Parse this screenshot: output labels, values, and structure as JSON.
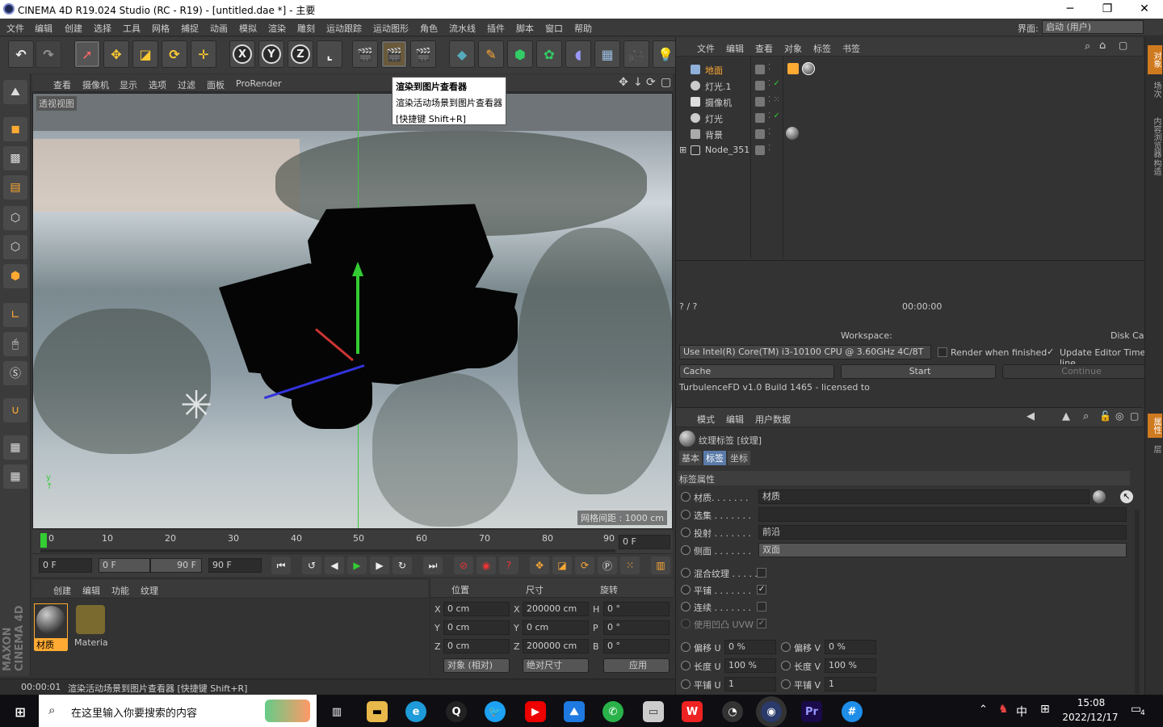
{
  "window": {
    "title": "CINEMA 4D R19.024 Studio (RC - R19) - [untitled.dae *] - 主要",
    "minimize": "─",
    "maximize": "❐",
    "close": "✕"
  },
  "menu": {
    "items": [
      "文件",
      "编辑",
      "创建",
      "选择",
      "工具",
      "网格",
      "捕捉",
      "动画",
      "模拟",
      "渲染",
      "雕刻",
      "运动跟踪",
      "运动图形",
      "角色",
      "流水线",
      "插件",
      "脚本",
      "窗口",
      "帮助"
    ],
    "layout_label": "界面:",
    "layout_value": "启动 (用户)"
  },
  "toolbar": {
    "x": "X",
    "y": "Y",
    "z": "Z"
  },
  "tooltip": {
    "title": "渲染到图片查看器",
    "desc": "渲染活动场景到图片查看器",
    "shortcut": "[快捷键 Shift+R]"
  },
  "viewport": {
    "menu": [
      "查看",
      "摄像机",
      "显示",
      "选项",
      "过滤",
      "面板",
      "ProRender"
    ],
    "name": "透视视图",
    "grid": "网格间距 : 1000 cm"
  },
  "timeline": {
    "ticks": [
      "0",
      "10",
      "20",
      "30",
      "40",
      "50",
      "60",
      "70",
      "80",
      "90"
    ],
    "end": "0 F"
  },
  "controls": {
    "start": "0 F",
    "range_start": "0 F",
    "range_end": "90 F",
    "end": "90 F"
  },
  "materials": {
    "menu": [
      "创建",
      "编辑",
      "功能",
      "纹理"
    ],
    "items": [
      {
        "label": "材质"
      },
      {
        "label": "Materia"
      }
    ]
  },
  "coords": {
    "headers": [
      "位置",
      "尺寸",
      "旋转"
    ],
    "rows": [
      {
        "axis": "X",
        "pos": "0 cm",
        "size": "200000 cm",
        "rot_axis": "H",
        "rot": "0 °"
      },
      {
        "axis": "Y",
        "pos": "0 cm",
        "size": "0 cm",
        "rot_axis": "P",
        "rot": "0 °"
      },
      {
        "axis": "Z",
        "pos": "0 cm",
        "size": "200000 cm",
        "rot_axis": "B",
        "rot": "0 °"
      }
    ],
    "mode": "对象 (相对)",
    "size_mode": "绝对尺寸",
    "apply": "应用"
  },
  "status": {
    "time": "00:00:01",
    "text": "渲染活动场景到图片查看器 [快捷键 Shift+R]"
  },
  "objects": {
    "menu": [
      "文件",
      "编辑",
      "查看",
      "对象",
      "标签",
      "书签"
    ],
    "rows": [
      "地面",
      "灯光.1",
      "摄像机",
      "灯光",
      "背景",
      "Node_351"
    ]
  },
  "turbulence": {
    "frame": "? / ?",
    "time": "00:00:00",
    "workspace": "Workspace:",
    "disk_cache": "Disk Cache:",
    "device": "Use  Intel(R) Core(TM) i3-10100 CPU @ 3.60GHz 4C/8T",
    "render_when_finished": "Render when finished",
    "update_timeline": "Update Editor Time-line",
    "cache": "Cache",
    "start": "Start",
    "continue": "Continue",
    "license": "TurbulenceFD v1.0 Build 1465 - licensed to"
  },
  "attributes": {
    "menu": [
      "模式",
      "编辑",
      "用户数据"
    ],
    "title": "纹理标签 [纹理]",
    "tabs": [
      "基本",
      "标签",
      "坐标"
    ],
    "section": "标签属性",
    "rows": [
      {
        "label": "材质. . . . . . .",
        "value": "材质"
      },
      {
        "label": "选集 . . . . . . .",
        "value": ""
      },
      {
        "label": "投射 . . . . . . .",
        "value": "前沿"
      },
      {
        "label": "侧面 . . . . . . .",
        "value": "双面"
      }
    ],
    "checks": [
      {
        "label": "混合纹理 . . . . .",
        "checked": ""
      },
      {
        "label": "平铺 . . . . . . .",
        "checked": "✓"
      },
      {
        "label": "连续 . . . . . . .",
        "checked": ""
      },
      {
        "label": "使用凹凸 UVW",
        "checked": "✓"
      }
    ],
    "pairs": [
      {
        "l1": "偏移 U",
        "v1": "0 %",
        "l2": "偏移 V",
        "v2": "0 %"
      },
      {
        "l1": "长度 U",
        "v1": "100 %",
        "l2": "长度 V",
        "v2": "100 %"
      },
      {
        "l1": "平铺 U",
        "v1": "1",
        "l2": "平铺 V",
        "v2": "1"
      }
    ]
  },
  "right_tabs": [
    "对象",
    "场次",
    "内容浏览器",
    "构造"
  ],
  "right_tabs2": [
    "属性",
    "层"
  ],
  "taskbar": {
    "search": "在这里输入你要搜索的内容",
    "time": "15:08",
    "date": "2022/12/17",
    "lang": "中",
    "notif": "4"
  }
}
